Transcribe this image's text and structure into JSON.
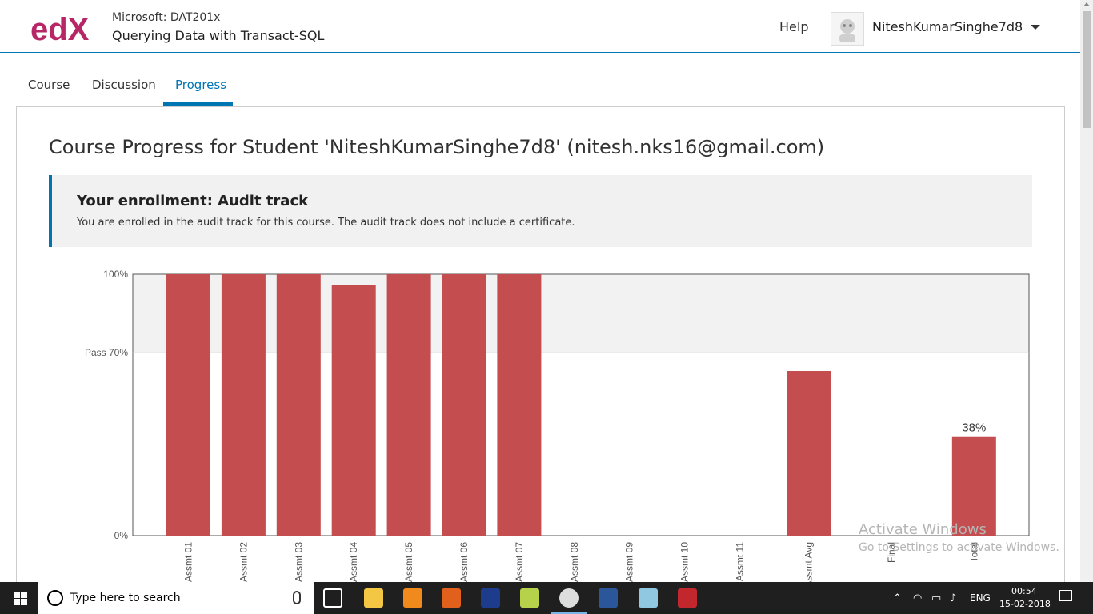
{
  "header": {
    "logo_text": "edX",
    "course_org": "Microsoft: DAT201x",
    "course_name": "Querying Data with Transact-SQL",
    "help": "Help",
    "username": "NiteshKumarSinghe7d8"
  },
  "tabs": [
    {
      "label": "Course",
      "active": false
    },
    {
      "label": "Discussion",
      "active": false
    },
    {
      "label": "Progress",
      "active": true
    }
  ],
  "page_title": "Course Progress for Student 'NiteshKumarSinghe7d8' (nitesh.nks16@gmail.com)",
  "enrollment": {
    "title": "Your enrollment: Audit track",
    "text": "You are enrolled in the audit track for this course. The audit track does not include a certificate."
  },
  "chart_data": {
    "type": "bar",
    "categories": [
      "Assmt 01",
      "Assmt 02",
      "Assmt 03",
      "Assmt 04",
      "Assmt 05",
      "Assmt 06",
      "Assmt 07",
      "Assmt 08",
      "Assmt 09",
      "Assmt 10",
      "Assmt 11",
      "Assmt Avg",
      "Final",
      "Total"
    ],
    "values": [
      100,
      100,
      100,
      96,
      100,
      100,
      100,
      0,
      0,
      0,
      0,
      63,
      0,
      38
    ],
    "y_ticks": [
      "100%",
      "Pass 70%",
      "0%"
    ],
    "pass_threshold": 70,
    "ylim": [
      0,
      100
    ],
    "data_labels": {
      "Total": "38%"
    },
    "bar_color": "#c44d4f",
    "pass_band_color": "#f2f2f2"
  },
  "watermark": {
    "line1": "Activate Windows",
    "line2": "Go to Settings to activate Windows."
  },
  "taskbar": {
    "search_placeholder": "Type here to search",
    "language": "ENG",
    "time": "00:54",
    "date": "15-02-2018"
  }
}
